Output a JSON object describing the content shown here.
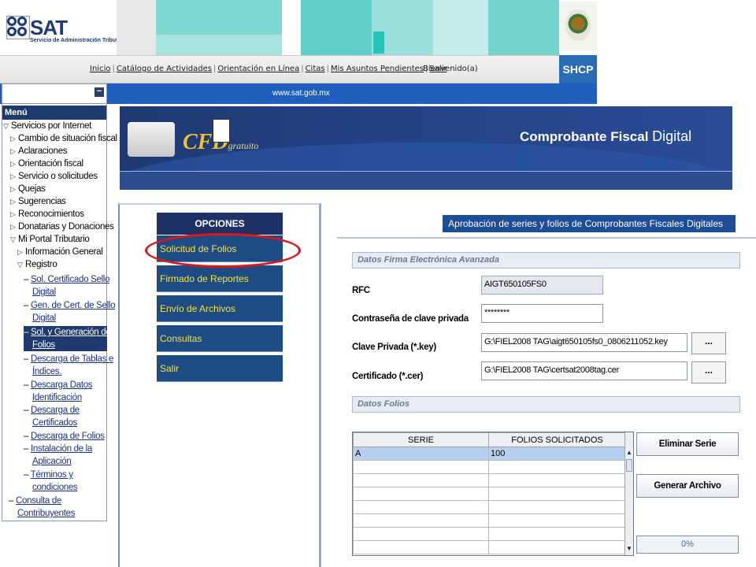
{
  "header": {
    "logo_text": "SAT",
    "logo_subtitle": "Servicio de Administración Tributaria",
    "nav_links": [
      "Inicio",
      "Catálogo de Actividades",
      "Orientación en Línea",
      "Citas",
      "Mis Asuntos Pendientes",
      "Salir"
    ],
    "welcome": "Bienvenido(a)",
    "shcp": "SHCP",
    "url": "www.sat.gob.mx",
    "tile_colors": [
      "#6fd1cc",
      "#9ee0dc",
      "#2fc7c0",
      "#ffffff"
    ]
  },
  "sidebar": {
    "collapse_symbol": "−",
    "title": "Menú",
    "items": [
      {
        "label": "Servicios por Internet",
        "level": 0,
        "state": "open"
      },
      {
        "label": "Cambio de situación fiscal",
        "level": 1,
        "state": "closed"
      },
      {
        "label": "Aclaraciones",
        "level": 1,
        "state": "closed"
      },
      {
        "label": "Orientación fiscal",
        "level": 1,
        "state": "closed"
      },
      {
        "label": "Servicio o solicitudes",
        "level": 1,
        "state": "closed"
      },
      {
        "label": "Quejas",
        "level": 1,
        "state": "closed"
      },
      {
        "label": "Sugerencias",
        "level": 1,
        "state": "closed"
      },
      {
        "label": "Reconocimientos",
        "level": 1,
        "state": "closed"
      },
      {
        "label": "Donatarias y Donaciones",
        "level": 1,
        "state": "closed"
      },
      {
        "label": "Mi Portal Tributario",
        "level": 1,
        "state": "open"
      },
      {
        "label": "Información General",
        "level": 2,
        "state": "closed"
      },
      {
        "label": "Registro",
        "level": 2,
        "state": "open"
      }
    ],
    "registro_links": [
      {
        "lines": [
          "Sol. Certificado Sello",
          "Digital"
        ]
      },
      {
        "lines": [
          "Gen. de Cert. de Sello",
          "Digital"
        ]
      },
      {
        "lines": [
          "Sol. y Generación de",
          "Folios"
        ],
        "selected": true
      },
      {
        "lines": [
          "Descarga de Tablas e",
          "Índices."
        ]
      },
      {
        "lines": [
          "Descarga Datos",
          "Identificación"
        ]
      },
      {
        "lines": [
          "Descarga de",
          "Certificados"
        ]
      },
      {
        "lines": [
          "Descarga de Folios"
        ]
      },
      {
        "lines": [
          "Instalación de la",
          "Aplicación"
        ]
      },
      {
        "lines": [
          "Términos y",
          "condiciones"
        ]
      }
    ],
    "bottom_link": [
      "Consulta de",
      "Contribuyentes"
    ]
  },
  "cfd": {
    "logo": "CFD",
    "logo_suffix": "gratuito",
    "title_bold": "Comprobante Fiscal",
    "title_thin": "Digital"
  },
  "options": {
    "header": "OPCIONES",
    "items": [
      "Solicitud de Folios",
      "Firmado de Reportes",
      "Envío de Archivos",
      "Consultas",
      "Salir"
    ]
  },
  "form": {
    "title": "Aprobación de series y folios de Comprobantes Fiscales Digitales",
    "section_signature": "Datos Firma Electrónica Avanzada",
    "rfc_label": "RFC",
    "rfc_value": "AIGT650105FS0",
    "password_label": "Contraseña de clave privada",
    "password_value": "********",
    "key_label": "Clave Privada (*.key)",
    "key_value": "G:\\FIEL2008 TAG\\aigt650105fs0_0806211052.key",
    "cert_label": "Certificado (*.cer)",
    "cert_value": "G:\\FIEL2008 TAG\\certsat2008tag.cer",
    "browse": "...",
    "section_folios": "Datos Folios",
    "grid_headers": [
      "SERIE",
      "FOLIOS SOLICITADOS"
    ],
    "grid_rows": [
      [
        "A",
        "100"
      ],
      [
        "",
        ""
      ],
      [
        "",
        ""
      ],
      [
        "",
        ""
      ],
      [
        "",
        ""
      ],
      [
        "",
        ""
      ],
      [
        "",
        ""
      ],
      [
        "",
        ""
      ]
    ],
    "delete_series": "Eliminar Serie",
    "generate_file": "Generar Archivo",
    "progress": "0%"
  }
}
